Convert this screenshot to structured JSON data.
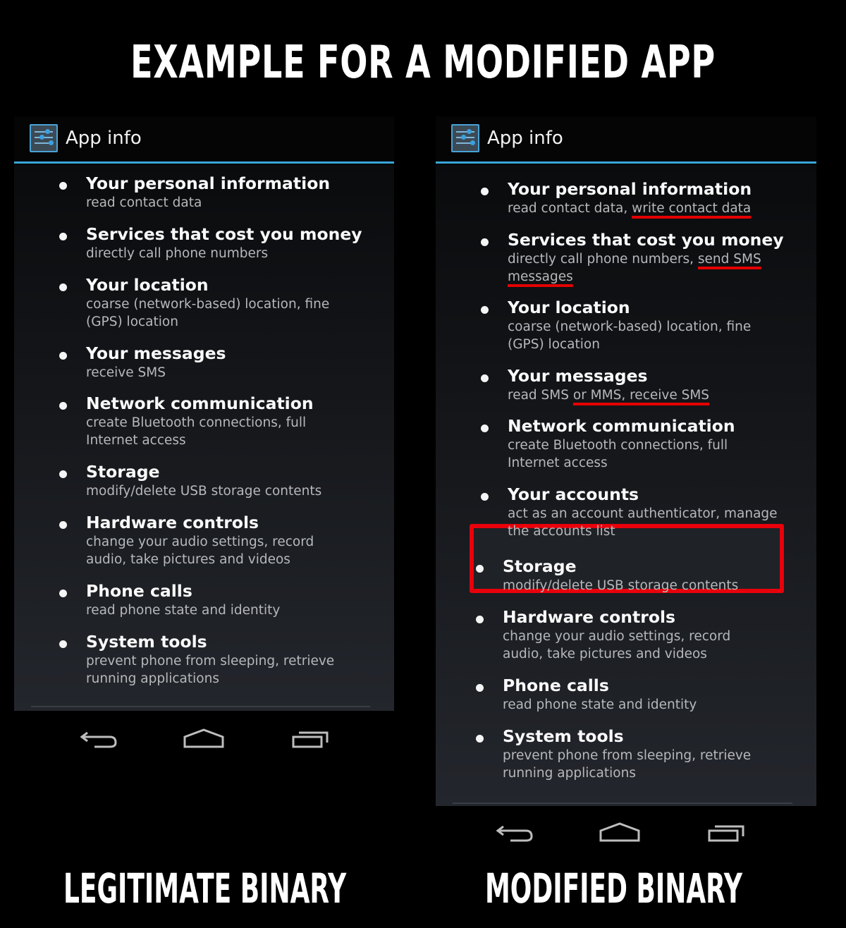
{
  "headline": "EXAMPLE FOR A MODIFIED APP",
  "panels": {
    "left": {
      "caption": "LEGITIMATE BINARY",
      "actionbar": {
        "icon": "settings-sliders-icon",
        "title": "App info"
      },
      "permissions": [
        {
          "title": "Your personal information",
          "desc": "read contact data"
        },
        {
          "title": "Services that cost you money",
          "desc": "directly call phone numbers"
        },
        {
          "title": "Your location",
          "desc": "coarse (network-based) location, fine (GPS) location"
        },
        {
          "title": "Your messages",
          "desc": "receive SMS"
        },
        {
          "title": "Network communication",
          "desc": "create Bluetooth connections, full Internet access"
        },
        {
          "title": "Storage",
          "desc": "modify/delete USB storage contents"
        },
        {
          "title": "Hardware controls",
          "desc": "change your audio settings, record audio, take pictures and videos"
        },
        {
          "title": "Phone calls",
          "desc": "read phone state and identity"
        },
        {
          "title": "System tools",
          "desc": "prevent phone from sleeping, retrieve running applications"
        }
      ],
      "navbar": [
        "back-icon",
        "home-icon",
        "recent-apps-icon"
      ]
    },
    "right": {
      "caption": "MODIFIED BINARY",
      "actionbar": {
        "icon": "settings-sliders-icon",
        "title": "App info"
      },
      "permissions": [
        {
          "title": "Your personal information",
          "desc_plain": "read contact data, ",
          "desc_added": "write contact data",
          "desc_rest": ""
        },
        {
          "title": "Services that cost you money",
          "desc_plain": "directly call phone numbers, ",
          "desc_added": "send SMS messages",
          "desc_rest": ""
        },
        {
          "title": "Your location",
          "desc_plain": "coarse (network-based) location, fine (GPS) location",
          "desc_added": "",
          "desc_rest": ""
        },
        {
          "title": "Your messages",
          "desc_plain": "read SMS ",
          "desc_added": "or MMS, receive SMS",
          "desc_rest": ""
        },
        {
          "title": "Network communication",
          "desc_plain": "create Bluetooth connections, full Internet access",
          "desc_added": "",
          "desc_rest": ""
        },
        {
          "title": "Your accounts",
          "desc_plain": "act as an account authenticator, manage the accounts list",
          "desc_added": "",
          "desc_rest": "",
          "boxed": true
        },
        {
          "title": "Storage",
          "desc_plain": "modify/delete USB storage contents",
          "desc_added": "",
          "desc_rest": ""
        },
        {
          "title": "Hardware controls",
          "desc_plain": "change your audio settings, record audio, take pictures and videos",
          "desc_added": "",
          "desc_rest": ""
        },
        {
          "title": "Phone calls",
          "desc_plain": "read phone state and identity",
          "desc_added": "",
          "desc_rest": ""
        },
        {
          "title": "System tools",
          "desc_plain": "prevent phone from sleeping, retrieve running applications",
          "desc_added": "",
          "desc_rest": ""
        }
      ],
      "navbar": [
        "back-icon",
        "home-icon",
        "recent-apps-icon"
      ]
    }
  },
  "colors": {
    "accent": "#39a7d9",
    "highlight": "#e40000",
    "background": "#000000"
  }
}
